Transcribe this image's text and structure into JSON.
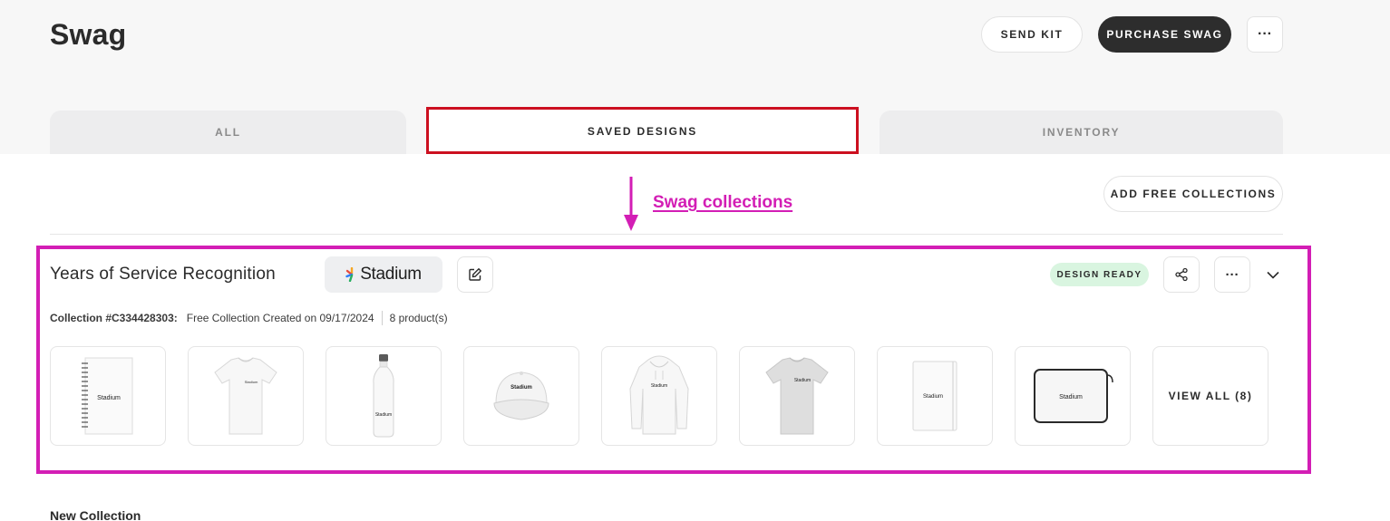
{
  "header": {
    "title": "Swag",
    "send_kit_label": "SEND KIT",
    "purchase_label": "PURCHASE SWAG",
    "more_label": "···"
  },
  "tabs": [
    {
      "label": "ALL"
    },
    {
      "label": "SAVED DESIGNS",
      "selected": true
    },
    {
      "label": "INVENTORY"
    }
  ],
  "annotation": {
    "label": "Swag collections",
    "color": "#d31eb5"
  },
  "toolbar": {
    "add_free_label": "ADD FREE COLLECTIONS"
  },
  "collection": {
    "title": "Years of Service Recognition",
    "brand_name": "Stadium",
    "status": "DESIGN READY",
    "id_label": "Collection #C334428303:",
    "created_text": "Free Collection Created on 09/17/2024",
    "count_text": "8 product(s)",
    "more_label": "···",
    "view_all_label": "VIEW ALL (8)",
    "products": [
      {
        "icon": "notebook-icon",
        "logo": "Stadium"
      },
      {
        "icon": "tshirt-icon",
        "logo": "Stadium"
      },
      {
        "icon": "water-bottle-icon",
        "logo": "Stadium"
      },
      {
        "icon": "cap-icon",
        "logo": "Stadium"
      },
      {
        "icon": "hoodie-icon",
        "logo": "Stadium"
      },
      {
        "icon": "grey-tshirt-icon",
        "logo": "Stadium"
      },
      {
        "icon": "hardcover-notebook-icon",
        "logo": "Stadium"
      },
      {
        "icon": "laptop-sleeve-icon",
        "logo": "Stadium"
      }
    ]
  },
  "next_section": {
    "title": "New Collection"
  },
  "colors": {
    "highlight_tab": "#cc1020",
    "highlight_collection": "#d31eb5",
    "status_bg": "#d9f5e0",
    "primary_button": "#2d2d2d"
  }
}
